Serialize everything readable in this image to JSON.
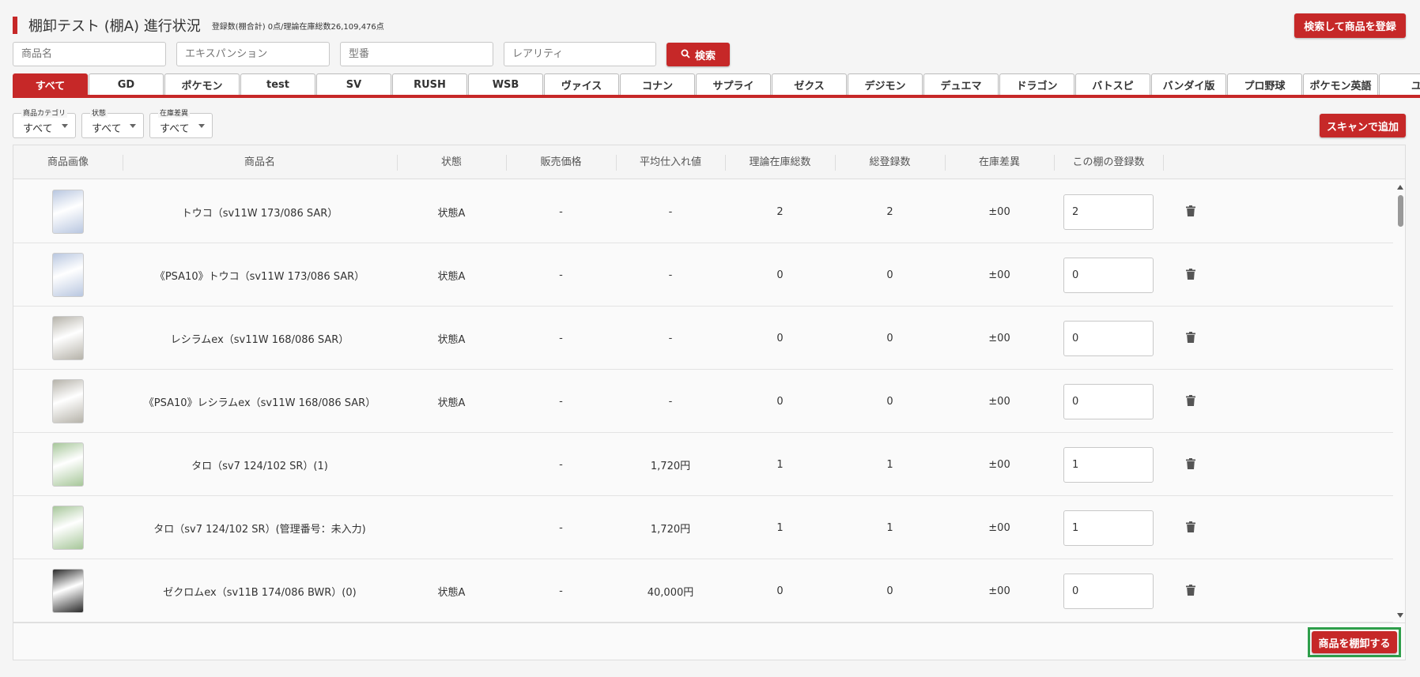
{
  "header": {
    "title": "棚卸テスト (棚A) 進行状況",
    "subtitle": "登録数(棚合計) 0点/理論在庫総数26,109,476点",
    "register_button": "検索して商品を登録"
  },
  "search": {
    "product_name_placeholder": "商品名",
    "expansion_placeholder": "エキスパンション",
    "model_number_placeholder": "型番",
    "rarity_placeholder": "レアリティ",
    "search_button": "検索"
  },
  "tabs": [
    "すべて",
    "GD",
    "ポケモン",
    "test",
    "SV",
    "RUSH",
    "WSB",
    "ヴァイス",
    "コナン",
    "サプライ",
    "ゼクス",
    "デジモン",
    "デュエマ",
    "ドラゴン",
    "バトスピ",
    "バンダイ版",
    "プロ野球",
    "ポケモン英語",
    "ユ"
  ],
  "active_tab": "すべて",
  "filters": {
    "category": {
      "label": "商品カテゴリ",
      "value": "すべて"
    },
    "condition": {
      "label": "状態",
      "value": "すべて"
    },
    "stock_diff": {
      "label": "在庫差異",
      "value": "すべて"
    }
  },
  "scan_button": "スキャンで追加",
  "table": {
    "columns": [
      "商品画像",
      "商品名",
      "状態",
      "販売価格",
      "平均仕入れ値",
      "理論在庫総数",
      "総登録数",
      "在庫差異",
      "この棚の登録数"
    ],
    "rows": [
      {
        "name": "トウコ（sv11W 173/086 SAR）",
        "condition": "状態A",
        "sale_price": "-",
        "avg_cost": "-",
        "theory_stock": "2",
        "total_registered": "2",
        "diff": "±00",
        "shelf_count": "2"
      },
      {
        "name": "《PSA10》トウコ（sv11W 173/086 SAR）",
        "condition": "状態A",
        "sale_price": "-",
        "avg_cost": "-",
        "theory_stock": "0",
        "total_registered": "0",
        "diff": "±00",
        "shelf_count": "0"
      },
      {
        "name": "レシラムex（sv11W 168/086 SAR）",
        "condition": "状態A",
        "sale_price": "-",
        "avg_cost": "-",
        "theory_stock": "0",
        "total_registered": "0",
        "diff": "±00",
        "shelf_count": "0"
      },
      {
        "name": "《PSA10》レシラムex（sv11W 168/086 SAR）",
        "condition": "状態A",
        "sale_price": "-",
        "avg_cost": "-",
        "theory_stock": "0",
        "total_registered": "0",
        "diff": "±00",
        "shelf_count": "0"
      },
      {
        "name": "タロ（sv7 124/102 SR）(1)",
        "condition": "",
        "sale_price": "-",
        "avg_cost": "1,720円",
        "theory_stock": "1",
        "total_registered": "1",
        "diff": "±00",
        "shelf_count": "1"
      },
      {
        "name": "タロ（sv7 124/102 SR）(管理番号：未入力)",
        "condition": "",
        "sale_price": "-",
        "avg_cost": "1,720円",
        "theory_stock": "1",
        "total_registered": "1",
        "diff": "±00",
        "shelf_count": "1"
      },
      {
        "name": "ゼクロムex（sv11B 174/086 BWR）(0)",
        "condition": "状態A",
        "sale_price": "-",
        "avg_cost": "40,000円",
        "theory_stock": "0",
        "total_registered": "0",
        "diff": "±00",
        "shelf_count": "0"
      }
    ]
  },
  "thumb_colors": [
    "#b9c7e0",
    "#b9c7e0",
    "#b6b3aa",
    "#b6b3aa",
    "#a7c79a",
    "#a7c79a",
    "#2a2a2a"
  ],
  "icons": {
    "search": "search-icon",
    "delete": "trash-icon"
  },
  "inventory_button": "商品を棚卸する",
  "colors": {
    "accent": "#c62828",
    "highlight": "#2e9e4a"
  }
}
